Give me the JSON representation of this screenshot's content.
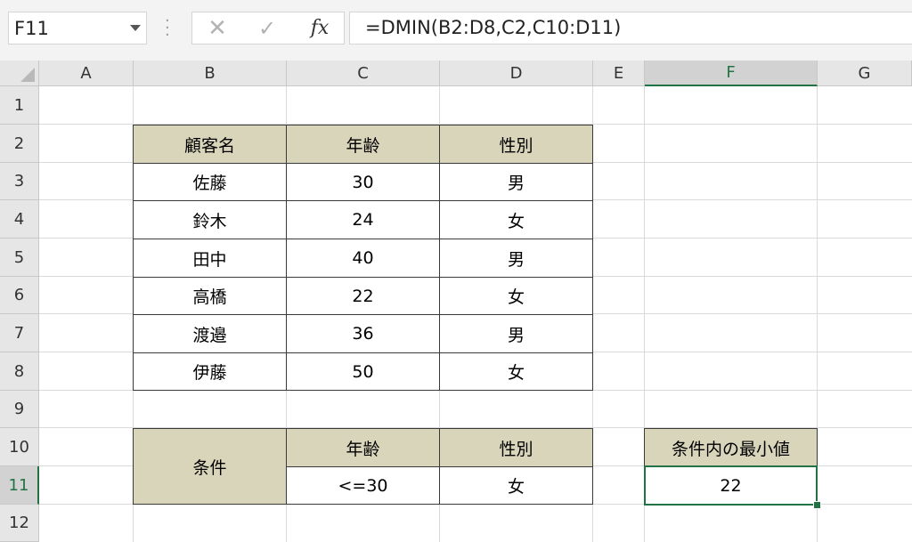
{
  "formula_bar": {
    "name_box": "F11",
    "cancel_icon": "✕",
    "enter_icon": "✓",
    "fx_label": "fx",
    "formula": "=DMIN(B2:D8,C2,C10:D11)"
  },
  "columns": [
    "A",
    "B",
    "C",
    "D",
    "E",
    "F",
    "G"
  ],
  "rows": [
    "1",
    "2",
    "3",
    "4",
    "5",
    "6",
    "7",
    "8",
    "9",
    "10",
    "11",
    "12"
  ],
  "selected_cell": "F11",
  "colors": {
    "header_fill": "#d9d5bb",
    "selection": "#217346"
  },
  "table": {
    "headers": [
      "顧客名",
      "年齢",
      "性別"
    ],
    "rows": [
      [
        "佐藤",
        "30",
        "男"
      ],
      [
        "鈴木",
        "24",
        "女"
      ],
      [
        "田中",
        "40",
        "男"
      ],
      [
        "高橋",
        "22",
        "女"
      ],
      [
        "渡邉",
        "36",
        "男"
      ],
      [
        "伊藤",
        "50",
        "女"
      ]
    ]
  },
  "criteria": {
    "label": "条件",
    "headers": [
      "年齢",
      "性別"
    ],
    "values": [
      "<=30",
      "女"
    ]
  },
  "result": {
    "label": "条件内の最小値",
    "value": "22"
  }
}
